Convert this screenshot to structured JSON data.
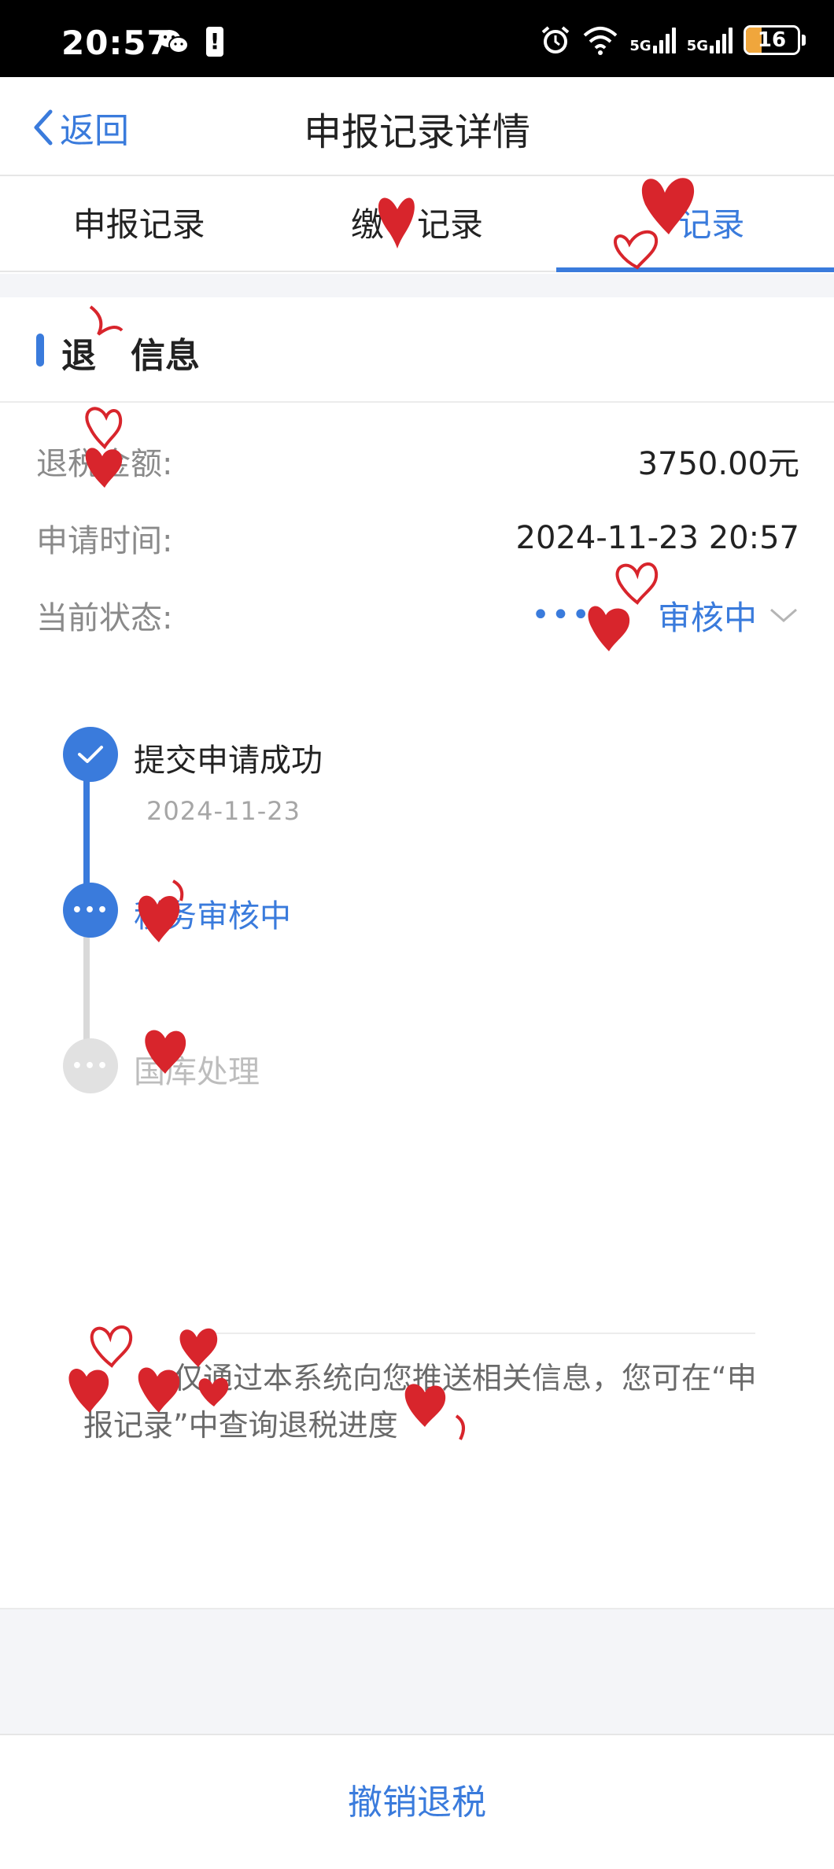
{
  "status_bar": {
    "time": "20:57",
    "network_1": "5G",
    "network_2": "5G",
    "battery": "16",
    "icons": [
      "wechat-icon",
      "battery-alert-icon",
      "alarm-icon",
      "wifi-icon",
      "signal-icon",
      "battery-icon"
    ]
  },
  "nav": {
    "back_label": "返回",
    "title": "申报记录详情"
  },
  "tabs": [
    {
      "label": "申报记录",
      "active": false
    },
    {
      "label": "缴　记录",
      "active": false
    },
    {
      "label": "　记录",
      "active": true
    }
  ],
  "section": {
    "title": "退　信息"
  },
  "details": {
    "amount_label": "退税金额:",
    "amount_value": "3750.00元",
    "time_label": "申请时间:",
    "time_value": "2024-11-23 20:57",
    "status_label": "当前状态:",
    "status_dots": "•••",
    "status_value": "审核中"
  },
  "timeline": [
    {
      "label": "提交申请成功",
      "date": "2024-11-23",
      "state": "done"
    },
    {
      "label": "税务审核中",
      "state": "current"
    },
    {
      "label": "国库处理",
      "state": "pending"
    }
  ],
  "notice": {
    "text": "　　　仅通过本系统向您推送相关信息，您可在“申报记录”中查询退税进度"
  },
  "bottom_button": {
    "label": "撤销退税"
  },
  "colors": {
    "accent": "#3a7bdc",
    "pending": "#d9d9d9",
    "heart": "#d8252c"
  }
}
